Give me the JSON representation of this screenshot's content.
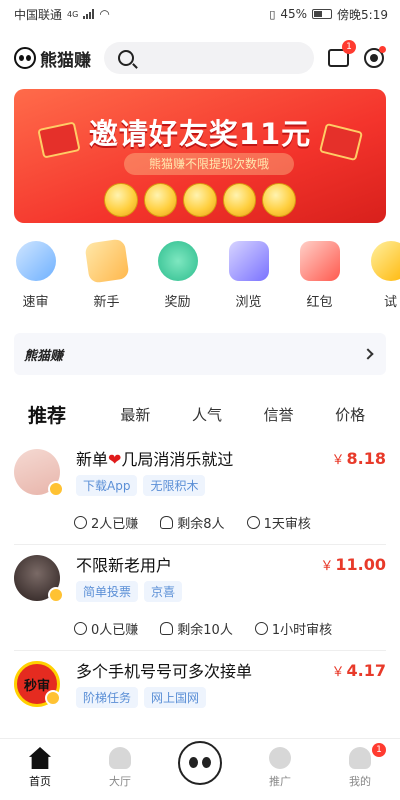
{
  "status_bar": {
    "carrier": "中国联通",
    "network": "4G",
    "battery": "45%",
    "time": "傍晚5:19"
  },
  "header": {
    "app_name": "熊猫赚",
    "search_placeholder": "",
    "message_badge": "1"
  },
  "banner": {
    "title": "邀请好友奖11元",
    "subtitle": "熊猫赚不限提现次数哦"
  },
  "categories": [
    {
      "label": "速审",
      "icon": "review-icon"
    },
    {
      "label": "新手",
      "icon": "newbie-icon"
    },
    {
      "label": "奖励",
      "icon": "reward-icon"
    },
    {
      "label": "浏览",
      "icon": "browse-icon"
    },
    {
      "label": "红包",
      "icon": "red-packet-icon"
    },
    {
      "label": "试",
      "icon": "trial-icon"
    }
  ],
  "notice": {
    "brand": "熊猫赚"
  },
  "tabs": [
    {
      "label": "推荐",
      "active": true
    },
    {
      "label": "最新",
      "active": false
    },
    {
      "label": "人气",
      "active": false
    },
    {
      "label": "信誉",
      "active": false
    },
    {
      "label": "价格",
      "active": false
    }
  ],
  "tasks": [
    {
      "title_prefix": "新单",
      "title_suffix": "几局消消乐就过",
      "heart": "❤",
      "tags": [
        "下载App",
        "无限积木"
      ],
      "currency": "￥",
      "price": "8.18",
      "earned": "2人已赚",
      "remaining": "剩余8人",
      "review_time": "1天审核"
    },
    {
      "title_prefix": "不限新老用户",
      "title_suffix": "",
      "heart": "",
      "tags": [
        "简单投票",
        "京喜"
      ],
      "currency": "￥",
      "price": "11.00",
      "earned": "0人已赚",
      "remaining": "剩余10人",
      "review_time": "1小时审核"
    },
    {
      "title_prefix": "多个手机号号可多次接单",
      "title_suffix": "",
      "heart": "",
      "avatar_text": "秒审",
      "tags": [
        "阶梯任务",
        "网上国网"
      ],
      "currency": "￥",
      "price": "4.17"
    }
  ],
  "tab_bar": {
    "items": [
      {
        "label": "首页",
        "icon": "home-icon",
        "active": true
      },
      {
        "label": "大厅",
        "icon": "hall-icon",
        "active": false
      },
      {
        "label": "",
        "icon": "panda-center-icon",
        "active": false
      },
      {
        "label": "推广",
        "icon": "promote-icon",
        "active": false
      },
      {
        "label": "我的",
        "icon": "profile-icon",
        "active": false,
        "badge": "1"
      }
    ]
  },
  "colors": {
    "accent_red": "#e83a2a",
    "tag_blue": "#5b8fd6",
    "banner_red": "#f4342c"
  }
}
